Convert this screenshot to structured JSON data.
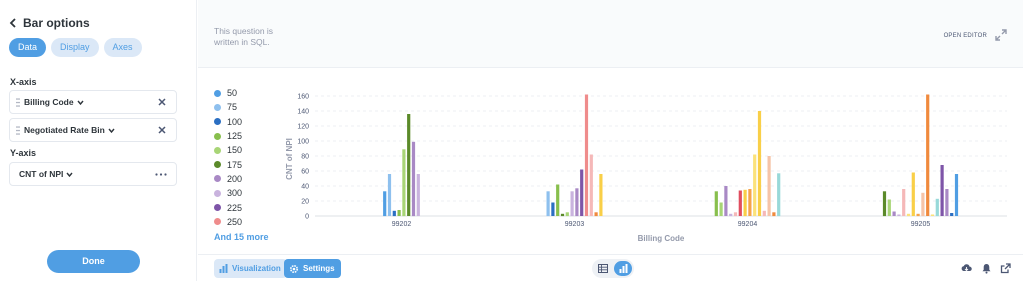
{
  "sidebar": {
    "title": "Bar options",
    "tabs": [
      {
        "label": "Data",
        "active": true
      },
      {
        "label": "Display",
        "active": false
      },
      {
        "label": "Axes",
        "active": false
      }
    ],
    "x_axis_label": "X-axis",
    "x_fields": [
      "Billing Code",
      "Negotiated Rate Bin"
    ],
    "y_axis_label": "Y-axis",
    "y_field": "CNT of NPI",
    "done_label": "Done"
  },
  "notice": {
    "text": "This question is written in SQL.",
    "open_editor": "OPEN EDITOR"
  },
  "legend": {
    "items": [
      {
        "label": "50",
        "color": "#509ee3"
      },
      {
        "label": "75",
        "color": "#8ec0ee"
      },
      {
        "label": "100",
        "color": "#2b6fc2"
      },
      {
        "label": "125",
        "color": "#88bf4d"
      },
      {
        "label": "150",
        "color": "#a8d576"
      },
      {
        "label": "175",
        "color": "#5b8a2a"
      },
      {
        "label": "200",
        "color": "#a989c5"
      },
      {
        "label": "300",
        "color": "#c9b3de"
      },
      {
        "label": "225",
        "color": "#7e55a8"
      },
      {
        "label": "250",
        "color": "#ef8c8c"
      }
    ],
    "more": "And 15 more"
  },
  "chart_data": {
    "type": "bar",
    "xlabel": "Billing Code",
    "ylabel": "CNT of NPI",
    "ylim": [
      0,
      160
    ],
    "yticks": [
      0,
      20,
      40,
      60,
      80,
      100,
      120,
      140,
      160
    ],
    "grid": true,
    "legend_position": "left",
    "categories": [
      "99202",
      "99203",
      "99204",
      "99205"
    ],
    "series_values": [
      [
        33,
        56,
        7,
        8,
        89,
        136,
        99,
        56
      ],
      [
        33,
        18,
        42,
        3,
        5,
        33,
        37,
        62,
        162,
        82,
        5,
        56
      ],
      [
        33,
        18,
        40,
        3,
        5,
        34,
        35,
        36,
        82,
        140,
        7,
        80,
        5,
        57
      ],
      [
        33,
        22,
        6,
        2,
        36,
        3,
        58,
        3,
        31,
        162,
        2,
        23,
        68,
        36,
        4,
        56
      ]
    ],
    "series_colors": [
      [
        "#509ee3",
        "#8ec0ee",
        "#2b6fc2",
        "#88bf4d",
        "#a8d576",
        "#5b8a2a",
        "#a989c5",
        "#c9b3de"
      ],
      [
        "#8ec0ee",
        "#2b6fc2",
        "#88bf4d",
        "#5b8a2a",
        "#a8d576",
        "#c9b3de",
        "#a989c5",
        "#7e55a8",
        "#ef8c8c",
        "#f5b8b8",
        "#f08a3e",
        "#f9cf48"
      ],
      [
        "#88bf4d",
        "#a8d576",
        "#a989c5",
        "#c9b3de",
        "#f5b8b8",
        "#e04d5f",
        "#f9cf48",
        "#f5a34a",
        "#fbe27a",
        "#f9cf48",
        "#f5b8b8",
        "#f6c4a8",
        "#f08a3e",
        "#98d9d9"
      ],
      [
        "#5b8a2a",
        "#a8d576",
        "#a989c5",
        "#c9b3de",
        "#f5b8b8",
        "#fbe27a",
        "#f9cf48",
        "#f5a34a",
        "#f6c4a8",
        "#f08a3e",
        "#fbe27a",
        "#98d9d9",
        "#7e55a8",
        "#a989c5",
        "#2b6fc2",
        "#509ee3"
      ]
    ]
  },
  "bottom": {
    "visualization": "Visualization",
    "settings": "Settings"
  }
}
